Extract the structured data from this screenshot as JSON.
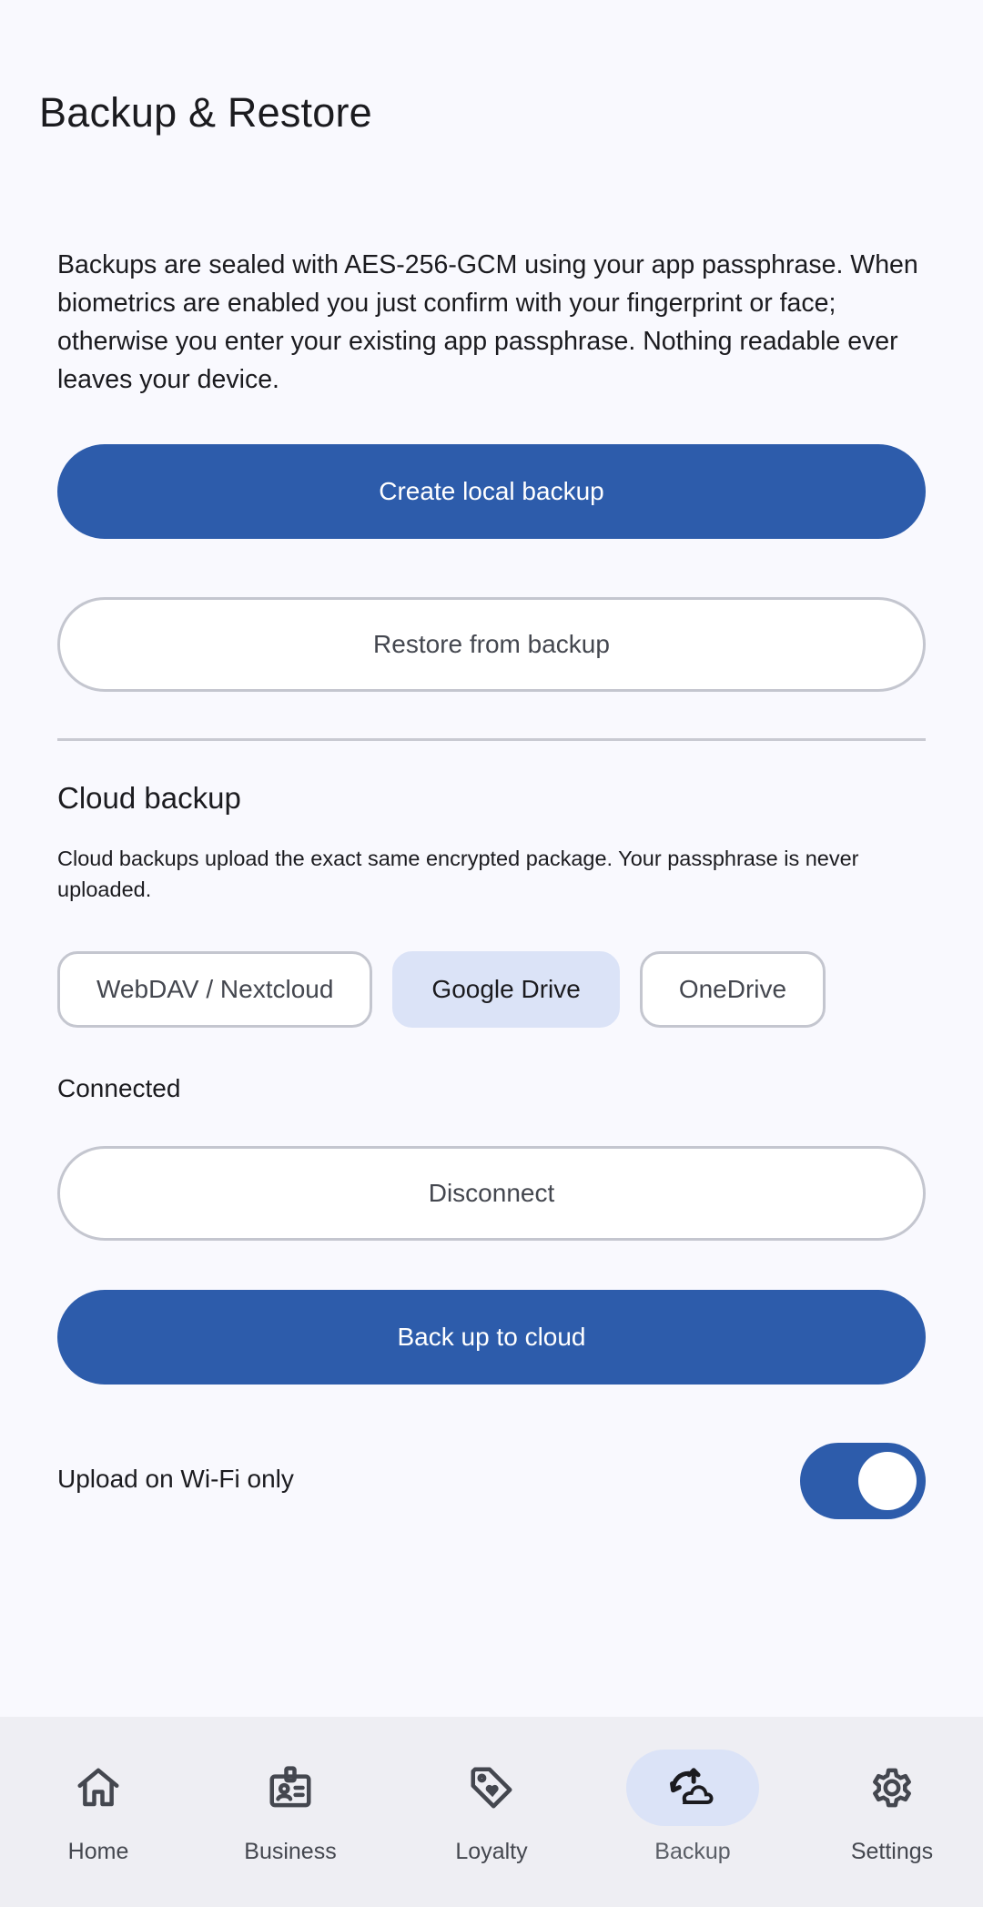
{
  "header": {
    "title": "Backup & Restore"
  },
  "intro": {
    "text": "Backups are sealed with AES-256-GCM using your app passphrase. When biometrics are enabled you just confirm with your fingerprint or face; otherwise you enter your existing app passphrase. Nothing readable ever leaves your device."
  },
  "local": {
    "create_label": "Create local backup",
    "restore_label": "Restore from backup"
  },
  "cloud": {
    "title": "Cloud backup",
    "description": "Cloud backups upload the exact same encrypted package. Your passphrase is never uploaded.",
    "providers": [
      {
        "label": "WebDAV / Nextcloud",
        "selected": false
      },
      {
        "label": "Google Drive",
        "selected": true
      },
      {
        "label": "OneDrive",
        "selected": false
      }
    ],
    "status": "Connected",
    "disconnect_label": "Disconnect",
    "backup_label": "Back up to cloud",
    "wifi_only_label": "Upload on Wi-Fi only",
    "wifi_only_enabled": true
  },
  "nav": {
    "items": [
      {
        "label": "Home",
        "icon": "home-icon",
        "active": false
      },
      {
        "label": "Business",
        "icon": "badge-icon",
        "active": false
      },
      {
        "label": "Loyalty",
        "icon": "tag-heart-icon",
        "active": false
      },
      {
        "label": "Backup",
        "icon": "cloud-sync-icon",
        "active": true
      },
      {
        "label": "Settings",
        "icon": "gear-icon",
        "active": false
      }
    ]
  },
  "colors": {
    "primary": "#2d5cab",
    "background": "#f9f9fe",
    "selected_container": "#dbe3f7",
    "outline": "#c4c6cf"
  }
}
